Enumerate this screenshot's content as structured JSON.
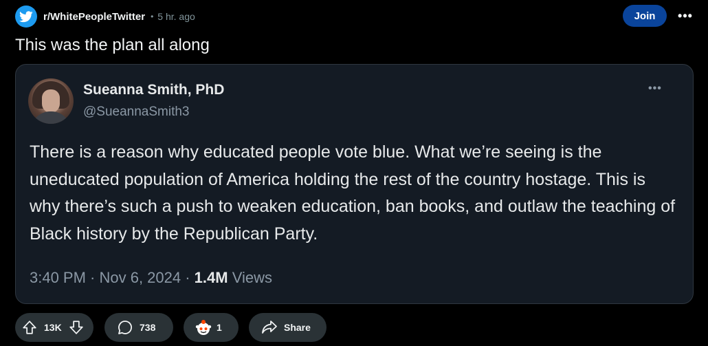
{
  "post": {
    "subreddit": "r/WhitePeopleTwitter",
    "separator": "•",
    "time": "5 hr. ago",
    "join_label": "Join",
    "more_label": "•••",
    "title": "This was the plan all along"
  },
  "tweet": {
    "name": "Sueanna Smith, PhD",
    "handle": "@SueannaSmith3",
    "more_label": "•••",
    "text": "There is a reason why educated people vote blue. What we’re seeing is the uneducated population of America holding the rest of the country hostage. This is why there’s such a push to weaken education, ban books, and outlaw the teaching of Black history by the Republican Party.",
    "timestamp": "3:40 PM · Nov 6, 2024 · ",
    "views_count": "1.4M",
    "views_label": " Views"
  },
  "actions": {
    "vote_count": "13K",
    "comment_count": "738",
    "award_count": "1",
    "share_label": "Share"
  },
  "colors": {
    "background": "#000000",
    "join_button": "#0a449b",
    "action_pill": "#2a3236",
    "tweet_card": "#141b24",
    "twitter_blue": "#1d9bf0"
  },
  "icons": [
    "twitter-bird-icon",
    "upvote-icon",
    "downvote-icon",
    "comment-icon",
    "award-icon",
    "share-icon",
    "more-options-icon"
  ]
}
